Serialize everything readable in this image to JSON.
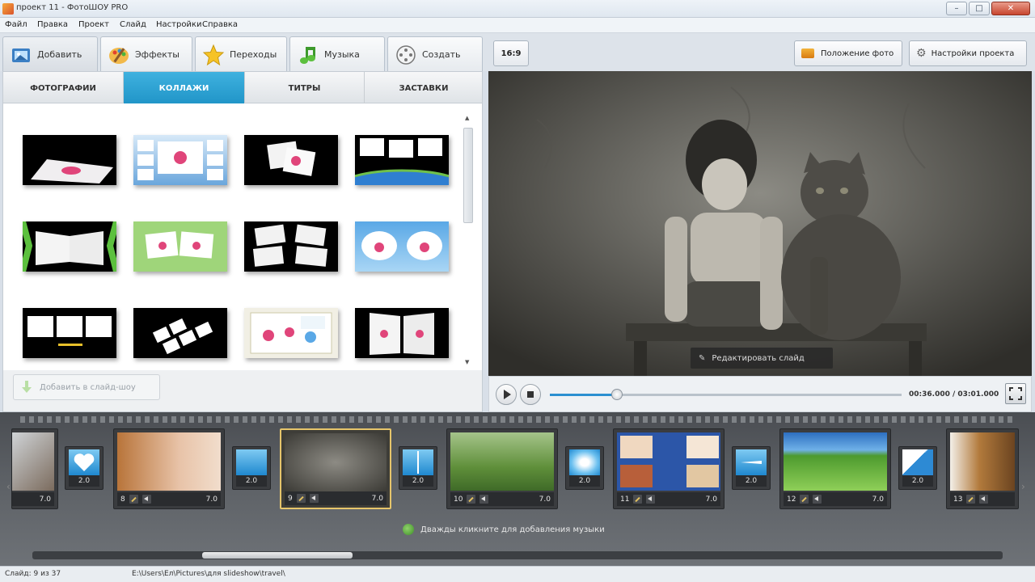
{
  "window": {
    "title": "проект 11 - ФотоШОУ PRO",
    "min": "–",
    "max": "□",
    "close": "✕"
  },
  "menu": [
    "Файл",
    "Правка",
    "Проект",
    "Слайд",
    "Настройки",
    "Справка"
  ],
  "tabs": [
    {
      "label": "Добавить",
      "icon": "add-photo-icon"
    },
    {
      "label": "Эффекты",
      "icon": "effects-palette-icon"
    },
    {
      "label": "Переходы",
      "icon": "star-icon"
    },
    {
      "label": "Музыка",
      "icon": "music-note-icon"
    },
    {
      "label": "Создать",
      "icon": "film-reel-icon"
    }
  ],
  "aspect_ratio": "16:9",
  "photo_position_label": "Положение фото",
  "project_settings_label": "Настройки проекта",
  "subtabs": [
    "ФОТОГРАФИИ",
    "КОЛЛАЖИ",
    "ТИТРЫ",
    "ЗАСТАВКИ"
  ],
  "active_subtab": "КОЛЛАЖИ",
  "add_to_slideshow": "Добавить в слайд-шоу",
  "edit_slide": "Редактировать слайд",
  "player": {
    "time": "00:36.000 / 03:01.000",
    "progress": 0.19
  },
  "timeline": {
    "slides": [
      {
        "num": "",
        "dur": "7.0",
        "image": "cat-and-child"
      },
      {
        "num": "8",
        "dur": "7.0",
        "image": "child-kissing-cat"
      },
      {
        "num": "9",
        "dur": "7.0",
        "image": "girl-and-cat-bw",
        "selected": true
      },
      {
        "num": "10",
        "dur": "7.0",
        "image": "boy-with-cat-on-grass"
      },
      {
        "num": "11",
        "dur": "7.0",
        "image": "photo-collage"
      },
      {
        "num": "12",
        "dur": "7.0",
        "image": "green-field-fisheye"
      },
      {
        "num": "13",
        "dur": "7.0",
        "image": "lion"
      }
    ],
    "transitions": [
      "2.0",
      "2.0",
      "2.0",
      "2.0",
      "2.0",
      "2.0"
    ],
    "music_hint": "Дважды кликните для добавления музыки"
  },
  "status": {
    "slide": "Слайд: 9 из 37",
    "path": "E:\\Users\\Ел\\Pictures\\для slideshow\\travel\\"
  },
  "colors": {
    "accent": "#1f94c7",
    "selected_slide": "#e6c56b"
  }
}
